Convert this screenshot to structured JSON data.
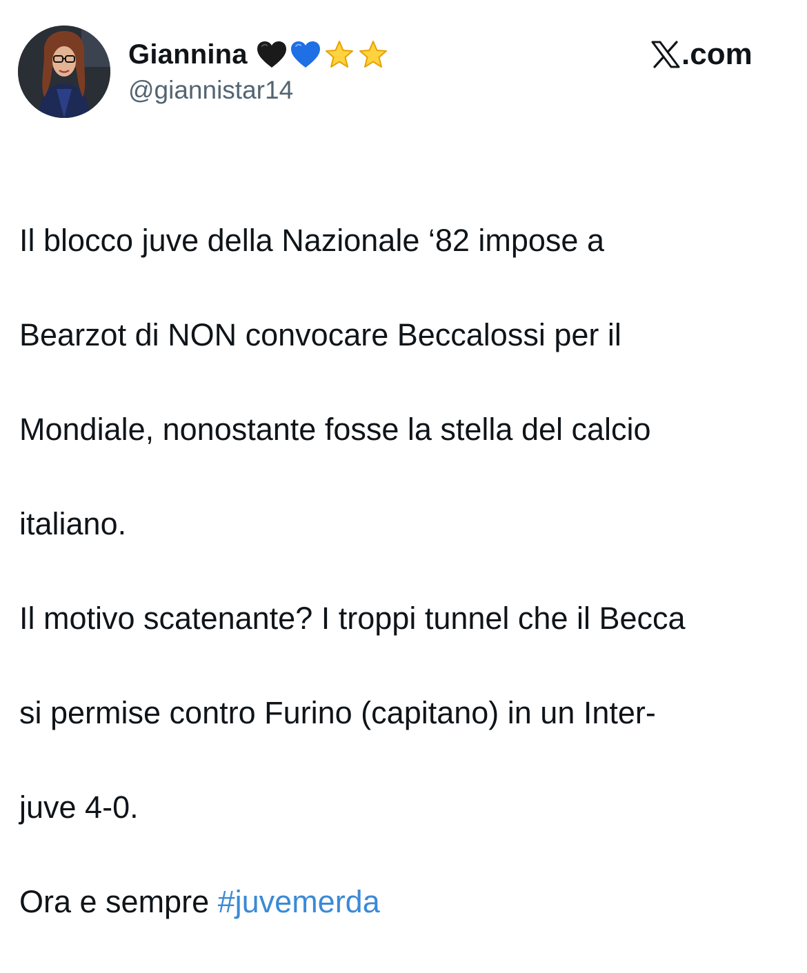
{
  "author": {
    "display_name": "Giannina",
    "handle": "@giannistar14",
    "badges": [
      "black-heart-icon",
      "blue-heart-icon",
      "star-icon",
      "star-icon"
    ],
    "avatar": "profile-photo"
  },
  "brand": {
    "icon": "x-logo-icon",
    "text": ".com"
  },
  "tweet": {
    "lines": [
      "Il blocco juve della Nazionale ‘82 impose a",
      "Bearzot di NON convocare Beccalossi per il",
      "Mondiale, nonostante fosse la stella del calcio",
      "italiano.",
      "Il motivo scatenante? I troppi tunnel che il Becca",
      "si permise contro Furino (capitano) in un Inter-",
      "juve 4-0."
    ],
    "last_line_prefix": "Ora e sempre ",
    "hashtag": "#juvemerda"
  },
  "colors": {
    "text": "#0f1419",
    "secondary": "#536471",
    "link": "#3b8ad6",
    "background": "#ffffff"
  }
}
